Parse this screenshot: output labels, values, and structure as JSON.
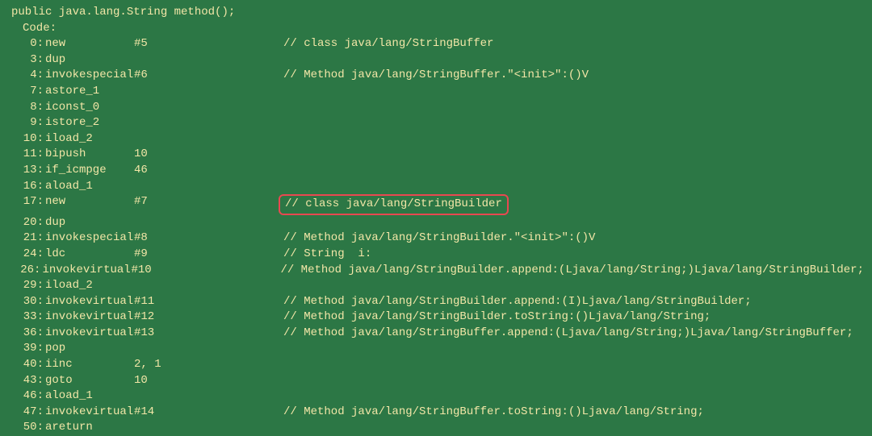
{
  "signature": "public java.lang.String method();",
  "codeLabel": "Code:",
  "lines": [
    {
      "offset": "0:",
      "opcode": "new",
      "operand": "#5",
      "comment": "// class java/lang/StringBuffer",
      "highlighted": false
    },
    {
      "offset": "3:",
      "opcode": "dup",
      "operand": "",
      "comment": "",
      "highlighted": false
    },
    {
      "offset": "4:",
      "opcode": "invokespecial",
      "operand": "#6",
      "comment": "// Method java/lang/StringBuffer.\"<init>\":()V",
      "highlighted": false
    },
    {
      "offset": "7:",
      "opcode": "astore_1",
      "operand": "",
      "comment": "",
      "highlighted": false
    },
    {
      "offset": "8:",
      "opcode": "iconst_0",
      "operand": "",
      "comment": "",
      "highlighted": false
    },
    {
      "offset": "9:",
      "opcode": "istore_2",
      "operand": "",
      "comment": "",
      "highlighted": false
    },
    {
      "offset": "10:",
      "opcode": "iload_2",
      "operand": "",
      "comment": "",
      "highlighted": false
    },
    {
      "offset": "11:",
      "opcode": "bipush",
      "operand": "10",
      "comment": "",
      "highlighted": false
    },
    {
      "offset": "13:",
      "opcode": "if_icmpge",
      "operand": "46",
      "comment": "",
      "highlighted": false
    },
    {
      "offset": "16:",
      "opcode": "aload_1",
      "operand": "",
      "comment": "",
      "highlighted": false
    },
    {
      "offset": "17:",
      "opcode": "new",
      "operand": "#7",
      "comment": "// class java/lang/StringBuilder",
      "highlighted": true
    },
    {
      "offset": "20:",
      "opcode": "dup",
      "operand": "",
      "comment": "",
      "highlighted": false
    },
    {
      "offset": "21:",
      "opcode": "invokespecial",
      "operand": "#8",
      "comment": "// Method java/lang/StringBuilder.\"<init>\":()V",
      "highlighted": false
    },
    {
      "offset": "24:",
      "opcode": "ldc",
      "operand": "#9",
      "comment": "// String  i:",
      "highlighted": false
    },
    {
      "offset": "26:",
      "opcode": "invokevirtual",
      "operand": "#10",
      "comment": "// Method java/lang/StringBuilder.append:(Ljava/lang/String;)Ljava/lang/StringBuilder;",
      "highlighted": false
    },
    {
      "offset": "29:",
      "opcode": "iload_2",
      "operand": "",
      "comment": "",
      "highlighted": false
    },
    {
      "offset": "30:",
      "opcode": "invokevirtual",
      "operand": "#11",
      "comment": "// Method java/lang/StringBuilder.append:(I)Ljava/lang/StringBuilder;",
      "highlighted": false
    },
    {
      "offset": "33:",
      "opcode": "invokevirtual",
      "operand": "#12",
      "comment": "// Method java/lang/StringBuilder.toString:()Ljava/lang/String;",
      "highlighted": false
    },
    {
      "offset": "36:",
      "opcode": "invokevirtual",
      "operand": "#13",
      "comment": "// Method java/lang/StringBuffer.append:(Ljava/lang/String;)Ljava/lang/StringBuffer;",
      "highlighted": false
    },
    {
      "offset": "39:",
      "opcode": "pop",
      "operand": "",
      "comment": "",
      "highlighted": false
    },
    {
      "offset": "40:",
      "opcode": "iinc",
      "operand": "2, 1",
      "comment": "",
      "highlighted": false
    },
    {
      "offset": "43:",
      "opcode": "goto",
      "operand": "10",
      "comment": "",
      "highlighted": false
    },
    {
      "offset": "46:",
      "opcode": "aload_1",
      "operand": "",
      "comment": "",
      "highlighted": false
    },
    {
      "offset": "47:",
      "opcode": "invokevirtual",
      "operand": "#14",
      "comment": "// Method java/lang/StringBuffer.toString:()Ljava/lang/String;",
      "highlighted": false
    },
    {
      "offset": "50:",
      "opcode": "areturn",
      "operand": "",
      "comment": "",
      "highlighted": false
    }
  ]
}
